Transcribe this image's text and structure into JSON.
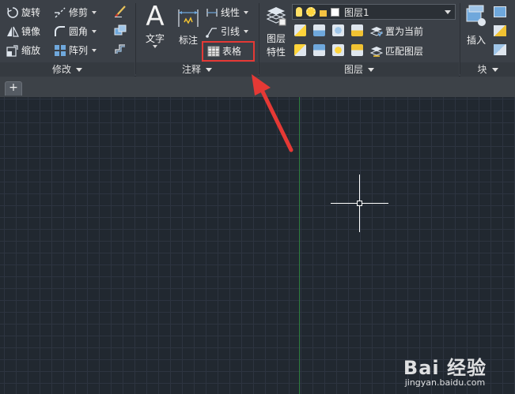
{
  "modify_panel": {
    "title": "修改",
    "rotate": "旋转",
    "trim": "修剪",
    "mirror": "镜像",
    "fillet": "圆角",
    "scale": "缩放",
    "array": "阵列"
  },
  "annotation_panel": {
    "title": "注释",
    "text_label": "文字",
    "text_glyph": "A",
    "dimension_label": "标注",
    "linear": "线性",
    "leader": "引线",
    "table": "表格"
  },
  "layers_panel": {
    "title": "图层",
    "properties_line1": "图层",
    "properties_line2": "特性",
    "current_layer": "图层1",
    "set_current": "置为当前",
    "match_layer": "匹配图层"
  },
  "block_panel": {
    "title": "块",
    "insert": "插入"
  },
  "tabs": {
    "new_tab_glyph": "+"
  },
  "watermark": {
    "logo": "Bai 经验",
    "url": "jingyan.baidu.com"
  },
  "colors": {
    "accent_highlight": "#e53935",
    "canvas_bg": "#212830",
    "ribbon_bg": "#3b4047",
    "y_axis": "#2f7f3f"
  }
}
